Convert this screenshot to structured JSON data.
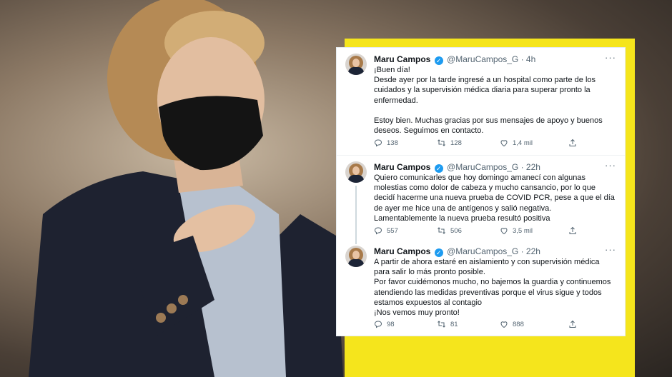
{
  "tweets": [
    {
      "name": "Maru Campos",
      "handle": "@MaruCampos_G · 4h",
      "lines": [
        "¡Buen día!",
        "Desde ayer por la tarde ingresé a un hospital como parte de los cuidados y la supervisión médica diaria para superar pronto la enfermedad.",
        "",
        "Estoy bien. Muchas gracias por sus mensajes de apoyo y buenos deseos. Seguimos en contacto."
      ],
      "replies": "138",
      "retweets": "128",
      "likes": "1,4 mil"
    },
    {
      "name": "Maru Campos",
      "handle": "@MaruCampos_G · 22h",
      "lines": [
        "Quiero comunicarles que hoy domingo amanecí con algunas molestias como dolor de cabeza y mucho cansancio, por lo que decidí hacerme una nueva prueba de COVID PCR, pese a que el día de ayer me hice una de antígenos y salió negativa.",
        "Lamentablemente la nueva prueba resultó positiva"
      ],
      "replies": "557",
      "retweets": "506",
      "likes": "3,5 mil"
    },
    {
      "name": "Maru Campos",
      "handle": "@MaruCampos_G · 22h",
      "lines": [
        "A partir de ahora estaré en aislamiento y con supervisión médica para salir lo más pronto posible.",
        "Por favor cuidémonos mucho, no bajemos la guardia y continuemos atendiendo las medidas preventivas porque el virus sigue y todos estamos expuestos al contagio",
        "¡Nos vemos muy pronto!"
      ],
      "replies": "98",
      "retweets": "81",
      "likes": "888"
    }
  ],
  "icons": {
    "more": "more-icon",
    "verified": "verified-badge-icon",
    "reply": "reply-icon",
    "retweet": "retweet-icon",
    "like": "like-icon",
    "share": "share-icon"
  },
  "colors": {
    "accent_yellow": "#f5e51c",
    "verified_blue": "#1d9bf0",
    "muted_text": "#536471"
  }
}
